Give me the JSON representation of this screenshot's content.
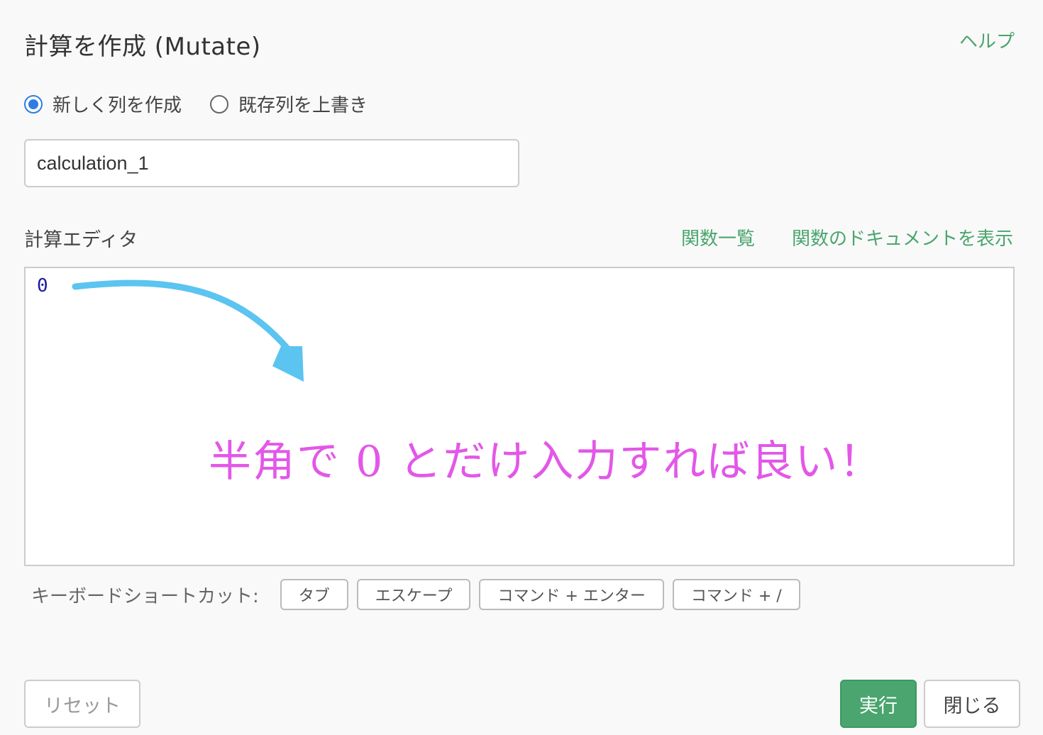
{
  "dialog": {
    "title": "計算を作成 (Mutate)",
    "help_label": "ヘルプ"
  },
  "mode": {
    "options": [
      {
        "label": "新しく列を作成",
        "checked": true
      },
      {
        "label": "既存列を上書き",
        "checked": false
      }
    ]
  },
  "column_name": {
    "value": "calculation_1"
  },
  "editor": {
    "label": "計算エディタ",
    "links": [
      "関数一覧",
      "関数のドキュメントを表示"
    ],
    "code": "0",
    "annotation": "半角で 0 とだけ入力すれば良い！",
    "annotation_color": "#e357e8",
    "arrow_color": "#5bc4f0"
  },
  "shortcuts": {
    "label": "キーボードショートカット:",
    "keys": [
      "タブ",
      "エスケープ",
      "コマンド + エンター",
      "コマンド + /"
    ]
  },
  "buttons": {
    "reset": "リセット",
    "run": "実行",
    "close": "閉じる"
  },
  "colors": {
    "accent_green": "#4aa56e",
    "radio_blue": "#2f7de1"
  }
}
